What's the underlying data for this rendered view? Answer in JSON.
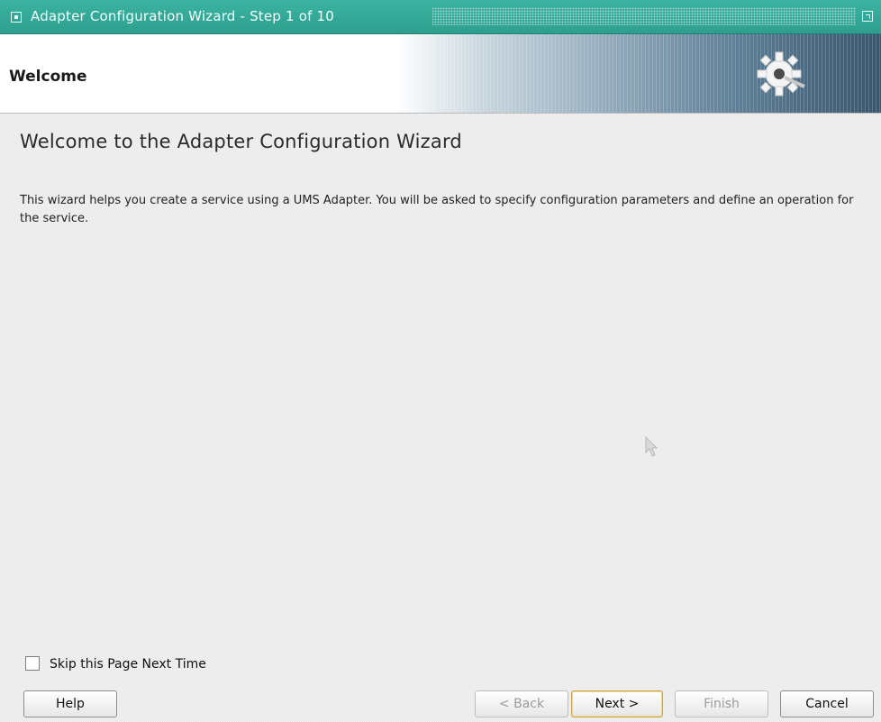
{
  "window": {
    "title": "Adapter Configuration Wizard - Step 1 of 10"
  },
  "header": {
    "title": "Welcome"
  },
  "main": {
    "heading": "Welcome to the Adapter Configuration Wizard",
    "description": "This wizard helps you create a service using a UMS Adapter. You will be asked to specify configuration parameters and define an operation for the service."
  },
  "options": {
    "skip_label": "Skip this Page Next Time",
    "skip_checked": false
  },
  "buttons": {
    "help": "Help",
    "back": "< Back",
    "next": "Next >",
    "finish": "Finish",
    "cancel": "Cancel"
  },
  "colors": {
    "titlebar": "#3bb3a1",
    "default_button_border": "#c9a64b"
  }
}
